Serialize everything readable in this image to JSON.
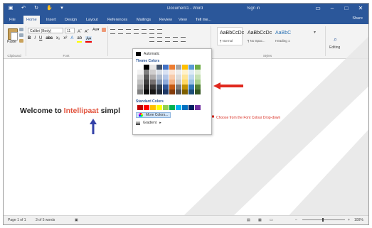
{
  "titlebar": {
    "qat_icons": [
      "save-icon",
      "undo-icon",
      "redo-icon",
      "touch-mode-icon",
      "customize-qat-icon"
    ],
    "doc_title": "Document1 - Word",
    "signin": "Sign in",
    "window_buttons": [
      "ribbon-display-icon",
      "minimize-icon",
      "maximize-icon",
      "close-icon"
    ]
  },
  "tabs": {
    "file": "File",
    "home": "Home",
    "insert": "Insert",
    "design": "Design",
    "layout": "Layout",
    "references": "References",
    "mailings": "Mailings",
    "review": "Review",
    "view": "View",
    "tell_me": "Tell me...",
    "share": "Share"
  },
  "ribbon": {
    "paste_label": "Paste",
    "clipboard_label": "Clipboard",
    "font_name": "Calibri (Body)",
    "font_size": "11",
    "font_group_label": "Font",
    "paragraph_label": "Paragraph",
    "styles_label": "Styles",
    "styles": [
      {
        "preview": "AaBbCcDc",
        "name": "¶ Normal"
      },
      {
        "preview": "AaBbCcDc",
        "name": "¶ No Spac..."
      },
      {
        "preview": "AaBbC",
        "name": "Heading 1"
      }
    ],
    "editing_label": "Editing"
  },
  "palette": {
    "automatic": "Automatic",
    "theme_title": "Theme Colors",
    "standard_title": "Standard Colors",
    "more_colors": "More Colors...",
    "gradient": "Gradient",
    "theme_colors": [
      [
        "#ffffff",
        "#000000",
        "#e7e6e6",
        "#44546a",
        "#4472c4",
        "#ed7d31",
        "#a5a5a5",
        "#ffc000",
        "#5b9bd5",
        "#70ad47"
      ],
      [
        "#f2f2f2",
        "#7f7f7f",
        "#d0cece",
        "#d6dce4",
        "#d9e2f3",
        "#fbe5d5",
        "#ededed",
        "#fff2cc",
        "#deebf6",
        "#e2efd9"
      ],
      [
        "#d8d8d8",
        "#595959",
        "#aeabab",
        "#adb9ca",
        "#b4c6e7",
        "#f7cbac",
        "#dbdbdb",
        "#fee599",
        "#bdd7ee",
        "#c5e0b3"
      ],
      [
        "#bfbfbf",
        "#3f3f3f",
        "#757070",
        "#8496b0",
        "#8eaadb",
        "#f4b183",
        "#c9c9c9",
        "#ffd965",
        "#9cc3e5",
        "#a8d08d"
      ],
      [
        "#a5a5a5",
        "#262626",
        "#3a3838",
        "#323f4f",
        "#2f5496",
        "#c55a11",
        "#7b7b7b",
        "#bf9000",
        "#2e75b5",
        "#538135"
      ],
      [
        "#7f7f7f",
        "#0c0c0c",
        "#171616",
        "#222a35",
        "#1f3864",
        "#833c0b",
        "#525252",
        "#7f6000",
        "#1e4e79",
        "#375623"
      ]
    ],
    "standard_colors": [
      "#c00000",
      "#ff0000",
      "#ffc000",
      "#ffff00",
      "#92d050",
      "#00b050",
      "#00b0f0",
      "#0070c0",
      "#002060",
      "#7030a0"
    ]
  },
  "document": {
    "text_before": "Welcome to ",
    "brand_word": "Intellipaat",
    "text_after": " simpl",
    "brand_color": "#e2533d",
    "annotation": "Choose from the Font Colour Drop-down"
  },
  "statusbar": {
    "page": "Page 1 of 1",
    "words": "3 of 5 words",
    "zoom": "100%"
  }
}
